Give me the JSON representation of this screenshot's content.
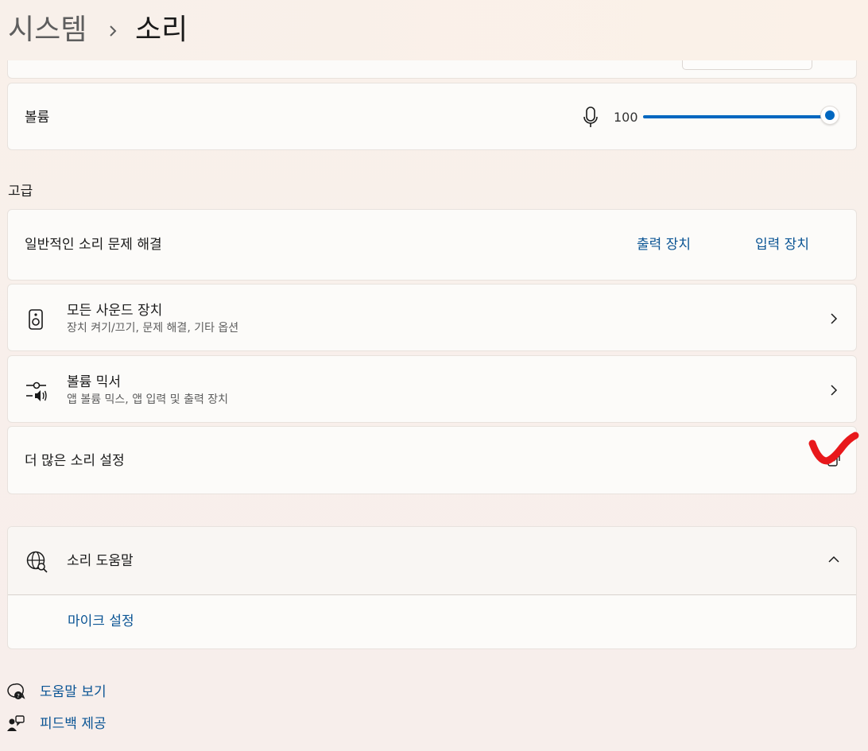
{
  "breadcrumb": {
    "parent": "시스템",
    "current": "소리"
  },
  "volume": {
    "label": "볼륨",
    "value_text": "100",
    "level": 100
  },
  "advanced": {
    "heading": "고급",
    "troubleshoot": {
      "label": "일반적인 소리 문제 해결",
      "output_link": "출력 장치",
      "input_link": "입력 장치"
    },
    "all_devices": {
      "title": "모든 사운드 장치",
      "subtitle": "장치 켜기/끄기, 문제 해결, 기타 옵션",
      "icon": "speaker-icon"
    },
    "mixer": {
      "title": "볼륨 믹서",
      "subtitle": "앱 볼륨 믹스, 앱 입력 및 출력 장치",
      "icon": "mixer-icon"
    },
    "more_settings": {
      "label": "더 많은 소리 설정",
      "icon": "open-external-icon"
    }
  },
  "help": {
    "title": "소리 도움말",
    "icon": "globe-search-icon",
    "links": [
      "마이크 설정"
    ]
  },
  "footer": {
    "get_help": "도움말 보기",
    "feedback": "피드백 제공"
  },
  "colors": {
    "accent": "#0067c0",
    "link": "#0a5494",
    "annotation": "#e8181b"
  }
}
